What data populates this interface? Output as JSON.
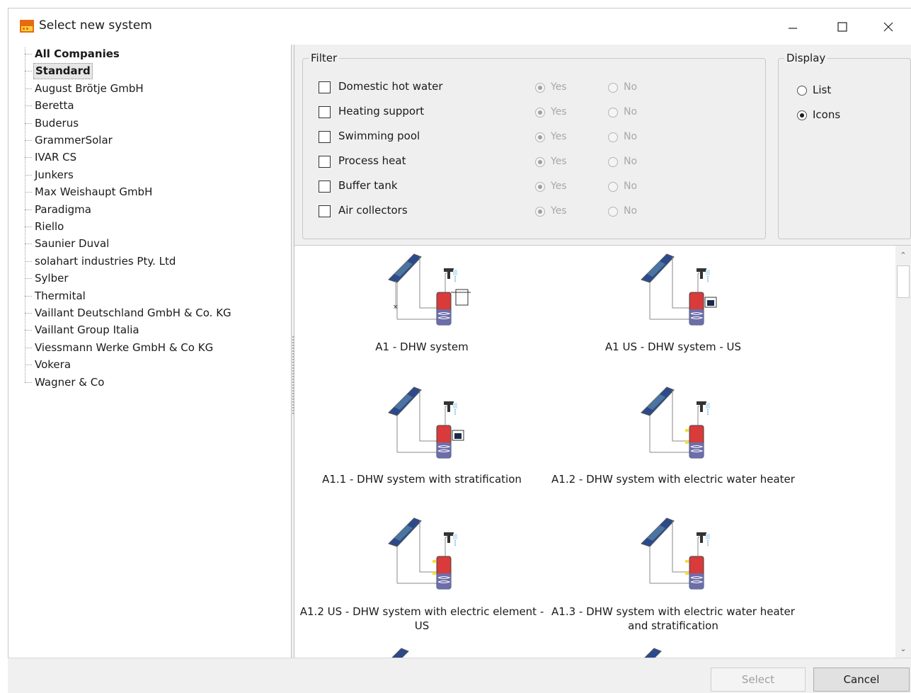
{
  "window": {
    "title": "Select new system",
    "icon": "app-orange-icon",
    "controls": [
      "minimize-icon",
      "maximize-icon",
      "close-icon"
    ]
  },
  "tree": {
    "items": [
      {
        "label": "All Companies",
        "bold": true
      },
      {
        "label": "Standard",
        "selected": true
      },
      {
        "label": "August Brötje GmbH"
      },
      {
        "label": "Beretta"
      },
      {
        "label": "Buderus"
      },
      {
        "label": "GrammerSolar"
      },
      {
        "label": "IVAR CS"
      },
      {
        "label": "Junkers"
      },
      {
        "label": "Max Weishaupt GmbH"
      },
      {
        "label": "Paradigma"
      },
      {
        "label": "Riello"
      },
      {
        "label": "Saunier Duval"
      },
      {
        "label": "solahart industries Pty. Ltd"
      },
      {
        "label": "Sylber"
      },
      {
        "label": "Thermital"
      },
      {
        "label": "Vaillant Deutschland GmbH & Co. KG"
      },
      {
        "label": "Vaillant Group Italia"
      },
      {
        "label": "Viessmann Werke GmbH & Co KG"
      },
      {
        "label": "Vokera"
      },
      {
        "label": "Wagner & Co"
      }
    ]
  },
  "filter": {
    "title": "Filter",
    "yes_label": "Yes",
    "no_label": "No",
    "rows": [
      {
        "label": "Domestic hot water",
        "checked": false,
        "value": "Yes"
      },
      {
        "label": "Heating support",
        "checked": false,
        "value": "Yes"
      },
      {
        "label": "Swimming pool",
        "checked": false,
        "value": "Yes"
      },
      {
        "label": "Process heat",
        "checked": false,
        "value": "Yes"
      },
      {
        "label": "Buffer tank",
        "checked": false,
        "value": "Yes"
      },
      {
        "label": "Air collectors",
        "checked": false,
        "value": "Yes"
      }
    ]
  },
  "display": {
    "title": "Display",
    "options": [
      {
        "label": "List",
        "selected": false
      },
      {
        "label": "Icons",
        "selected": true
      }
    ]
  },
  "systems": [
    {
      "label": "A1 - DHW system",
      "variant": "cross"
    },
    {
      "label": "A1 US - DHW system - US",
      "variant": "module"
    },
    {
      "label": "A1.1 - DHW system with stratification",
      "variant": "module"
    },
    {
      "label": "A1.2 - DHW system with electric water heater",
      "variant": "electric"
    },
    {
      "label": "A1.2 US - DHW system with electric element - US",
      "variant": "electric"
    },
    {
      "label": "A1.3 - DHW system with electric water heater and stratification",
      "variant": "electric"
    }
  ],
  "buttons": {
    "select": "Select",
    "cancel": "Cancel"
  },
  "colors": {
    "panel_bg": "#f0f0f0",
    "selected_bg": "#e6e6e6",
    "disabled_text": "#a8a8a8",
    "tank_red": "#d93a3a",
    "tank_blue": "#4a7fd0",
    "collector_blue": "#2b4a8c"
  }
}
